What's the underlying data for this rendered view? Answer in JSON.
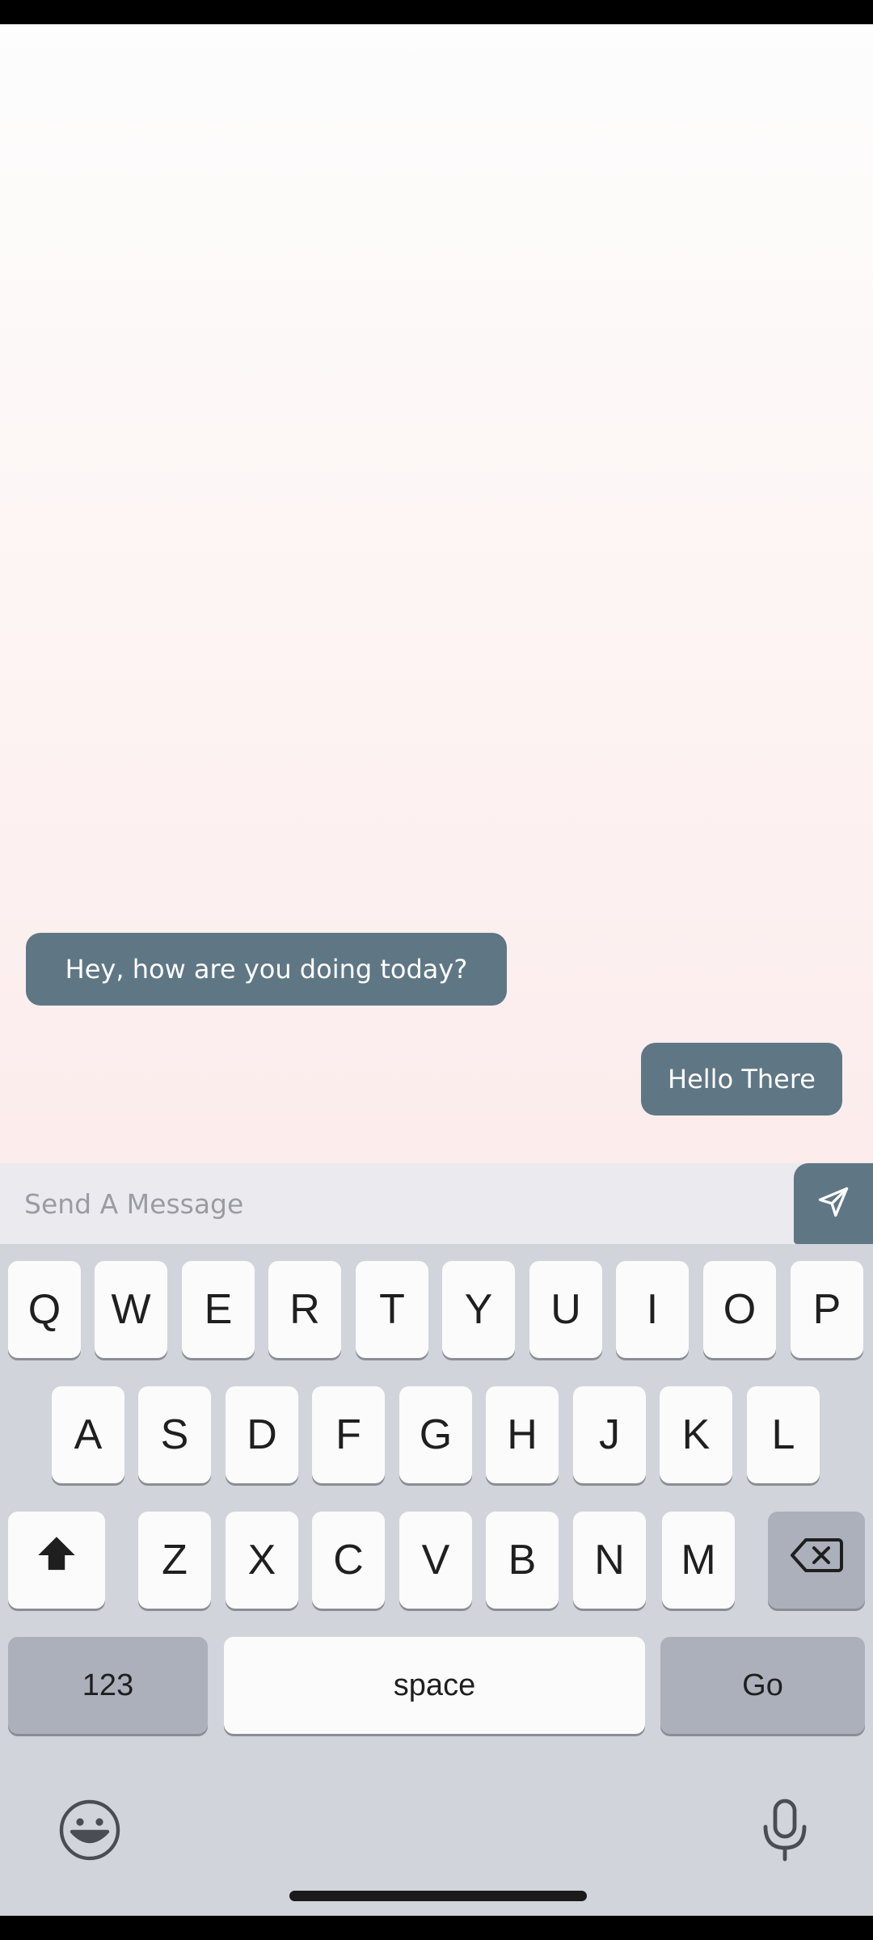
{
  "chat": {
    "messages": [
      {
        "direction": "incoming",
        "text": "Hey, how are you doing today?"
      },
      {
        "direction": "outgoing",
        "text": "Hello There"
      }
    ]
  },
  "composer": {
    "placeholder": "Send A Message",
    "value": "",
    "send_icon": "send-icon"
  },
  "keyboard": {
    "row1": [
      "Q",
      "W",
      "E",
      "R",
      "T",
      "Y",
      "U",
      "I",
      "O",
      "P"
    ],
    "row2": [
      "A",
      "S",
      "D",
      "F",
      "G",
      "H",
      "J",
      "K",
      "L"
    ],
    "row3": [
      "Z",
      "X",
      "C",
      "V",
      "B",
      "N",
      "M"
    ],
    "numbers_label": "123",
    "space_label": "space",
    "go_label": "Go",
    "icons": [
      "shift-icon",
      "backspace-icon",
      "emoji-icon",
      "microphone-icon"
    ]
  },
  "colors": {
    "bubble": "#5f7785",
    "keyboard_bg": "#d1d4da",
    "key_bg": "#fbfbfc",
    "key_dark_bg": "#abb0ba"
  }
}
